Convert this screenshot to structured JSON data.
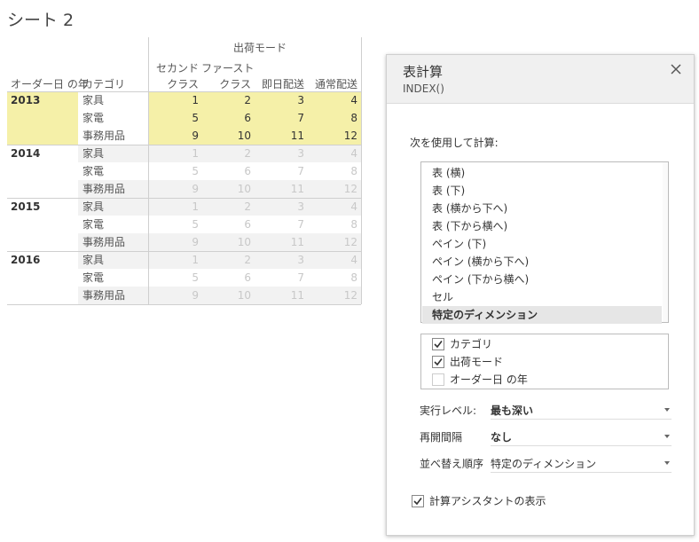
{
  "sheet": {
    "title": "シート 2"
  },
  "crosstab": {
    "column_group_header": "出荷モード",
    "row_headers": {
      "year": "オーダー日 の年",
      "category": "カテゴリ"
    },
    "columns": [
      {
        "line1": "セカンド",
        "line2": "クラス"
      },
      {
        "line1": "ファースト",
        "line2": "クラス"
      },
      {
        "line1": "",
        "line2": "即日配送"
      },
      {
        "line1": "",
        "line2": "通常配送"
      }
    ],
    "groups": [
      {
        "year": "2013",
        "highlighted": true,
        "rows": [
          {
            "category": "家具",
            "values": [
              "1",
              "2",
              "3",
              "4"
            ]
          },
          {
            "category": "家電",
            "values": [
              "5",
              "6",
              "7",
              "8"
            ]
          },
          {
            "category": "事務用品",
            "values": [
              "9",
              "10",
              "11",
              "12"
            ]
          }
        ]
      },
      {
        "year": "2014",
        "highlighted": false,
        "rows": [
          {
            "category": "家具",
            "values": [
              "1",
              "2",
              "3",
              "4"
            ]
          },
          {
            "category": "家電",
            "values": [
              "5",
              "6",
              "7",
              "8"
            ]
          },
          {
            "category": "事務用品",
            "values": [
              "9",
              "10",
              "11",
              "12"
            ]
          }
        ]
      },
      {
        "year": "2015",
        "highlighted": false,
        "rows": [
          {
            "category": "家具",
            "values": [
              "1",
              "2",
              "3",
              "4"
            ]
          },
          {
            "category": "家電",
            "values": [
              "5",
              "6",
              "7",
              "8"
            ]
          },
          {
            "category": "事務用品",
            "values": [
              "9",
              "10",
              "11",
              "12"
            ]
          }
        ]
      },
      {
        "year": "2016",
        "highlighted": false,
        "rows": [
          {
            "category": "家具",
            "values": [
              "1",
              "2",
              "3",
              "4"
            ]
          },
          {
            "category": "家電",
            "values": [
              "5",
              "6",
              "7",
              "8"
            ]
          },
          {
            "category": "事務用品",
            "values": [
              "9",
              "10",
              "11",
              "12"
            ]
          }
        ]
      }
    ],
    "colors": {
      "highlight": "#f5f0a8",
      "dimmed_text": "#c8c8c8"
    }
  },
  "panel": {
    "title": "表計算",
    "subtitle": "INDEX()",
    "close_icon": "close-icon",
    "compute_using_label": "次を使用して計算:",
    "compute_options": [
      "表 (横)",
      "表 (下)",
      "表 (横から下へ)",
      "表 (下から横へ)",
      "ペイン (下)",
      "ペイン (横から下へ)",
      "ペイン (下から横へ)",
      "セル",
      "特定のディメンション"
    ],
    "compute_selected": "特定のディメンション",
    "dimensions": [
      {
        "label": "カテゴリ",
        "checked": true
      },
      {
        "label": "出荷モード",
        "checked": true
      },
      {
        "label": "オーダー日 の年",
        "checked": false
      }
    ],
    "at_level": {
      "label": "実行レベル:",
      "value": "最も深い"
    },
    "restart_every": {
      "label": "再開間隔",
      "value": "なし"
    },
    "sort_order": {
      "label": "並べ替え順序",
      "value": "特定のディメンション"
    },
    "show_assistant": {
      "label": "計算アシスタントの表示",
      "checked": true
    }
  }
}
